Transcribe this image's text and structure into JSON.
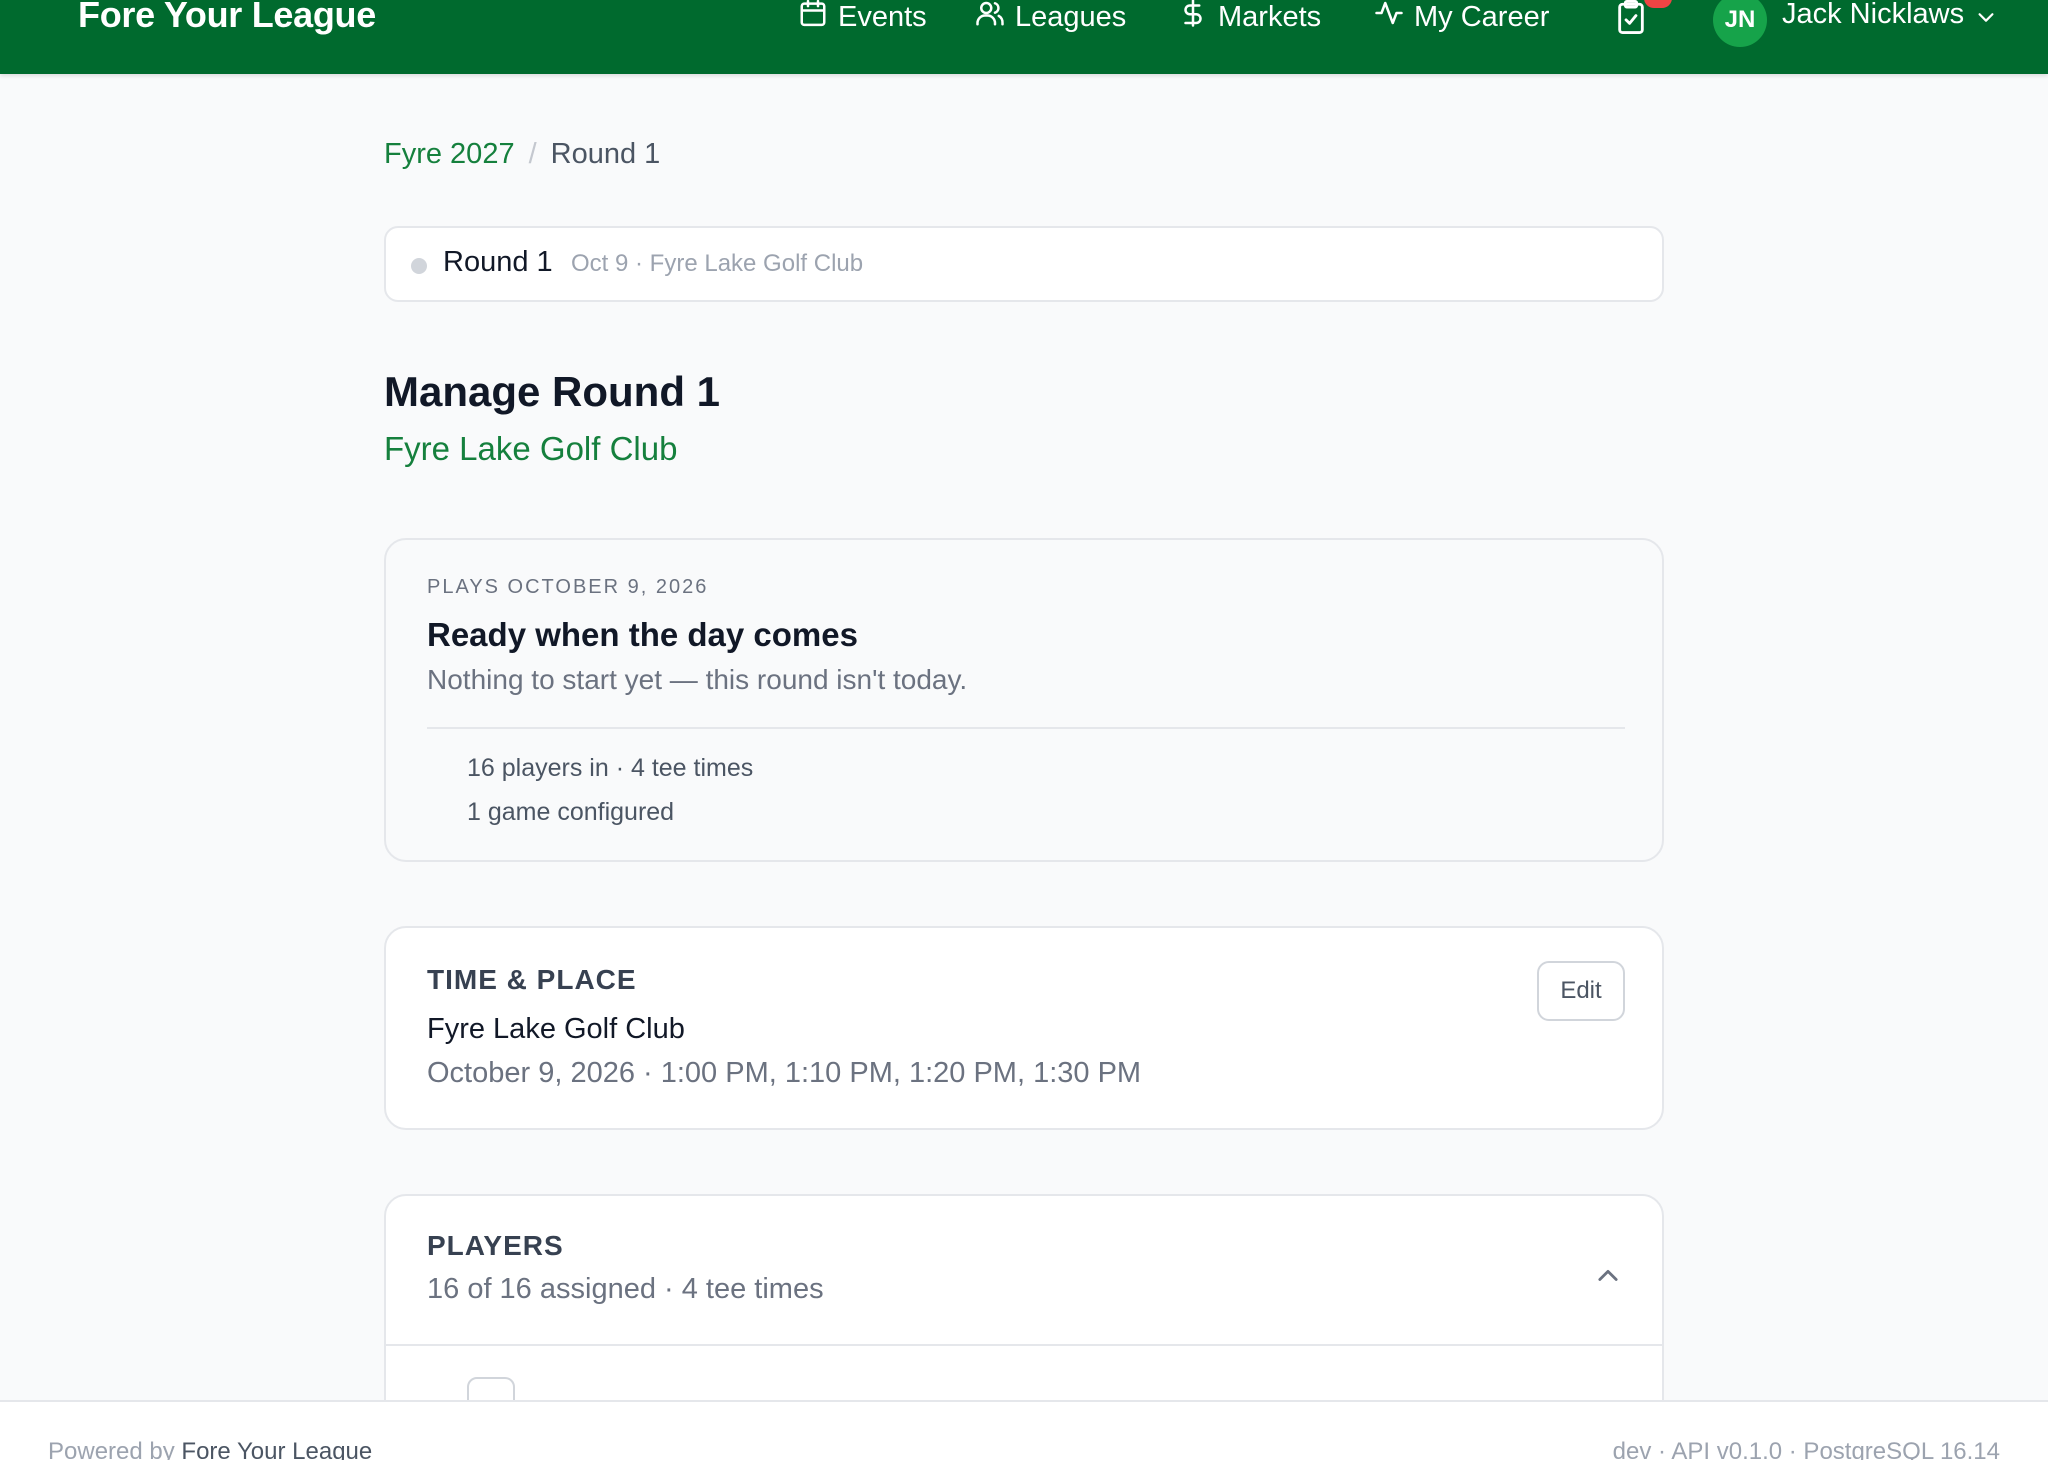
{
  "brand": {
    "name": "Fore Your League",
    "color": "#006a2e"
  },
  "nav": {
    "items": [
      {
        "label": "Events",
        "icon": "calendar-icon"
      },
      {
        "label": "Leagues",
        "icon": "users-icon"
      },
      {
        "label": "Markets",
        "icon": "dollar-icon"
      },
      {
        "label": "My Career",
        "icon": "activity-icon"
      }
    ],
    "tasks_icon": "clipboard-check-icon",
    "badge_color": "#ef4444",
    "user": {
      "initials": "JN",
      "name": "Jack Nicklaws",
      "avatar_color": "#16a34a"
    }
  },
  "breadcrumb": {
    "parent": "Fyre 2027",
    "separator": "/",
    "current": "Round 1"
  },
  "round_bar": {
    "title": "Round 1",
    "meta": "Oct 9 · Fyre Lake Golf Club"
  },
  "page": {
    "title": "Manage Round 1",
    "subtitle": "Fyre Lake Golf Club"
  },
  "status_card": {
    "eyebrow": "PLAYS OCTOBER 9, 2026",
    "title": "Ready when the day comes",
    "description": "Nothing to start yet — this round isn't today.",
    "lines": [
      "16 players in · 4 tee times",
      "1 game configured"
    ]
  },
  "time_place": {
    "label": "TIME & PLACE",
    "venue": "Fyre Lake Golf Club",
    "detail": "October 9, 2026 · 1:00 PM, 1:10 PM, 1:20 PM, 1:30 PM",
    "edit_label": "Edit"
  },
  "players": {
    "label": "PLAYERS",
    "summary": "16 of 16 assigned · 4 tee times"
  },
  "footer": {
    "powered_prefix": "Powered by",
    "powered_name": "Fore Your League",
    "version": "dev · API v0.1.0 · PostgreSQL 16.14"
  },
  "colors": {
    "accent": "#15803d",
    "muted": "#6b7280"
  }
}
